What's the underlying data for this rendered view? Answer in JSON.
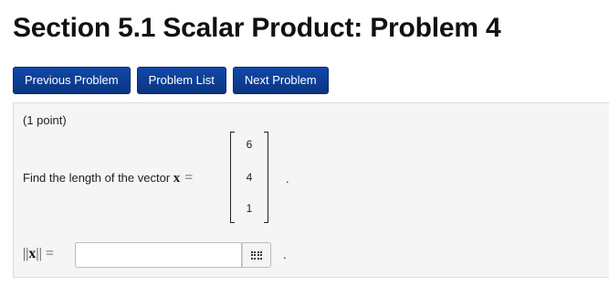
{
  "header": {
    "title": "Section 5.1 Scalar Product: Problem 4"
  },
  "nav": {
    "previous_label": "Previous Problem",
    "list_label": "Problem List",
    "next_label": "Next Problem"
  },
  "problem": {
    "points": "(1 point)",
    "prompt_text": "Find the length of the vector ",
    "vector_symbol": "x",
    "equals": "=",
    "vector": [
      "6",
      "4",
      "1"
    ],
    "trailing_period": ".",
    "norm_label_open": "||",
    "norm_label_symbol": "x",
    "norm_label_close": "||",
    "answer": {
      "value": "",
      "placeholder": ""
    },
    "answer_period": "."
  },
  "icons": {
    "palette": "grid-icon"
  },
  "colors": {
    "button_bg": "#0b3d91",
    "button_text": "#ffffff",
    "panel_bg": "#f5f5f5"
  }
}
